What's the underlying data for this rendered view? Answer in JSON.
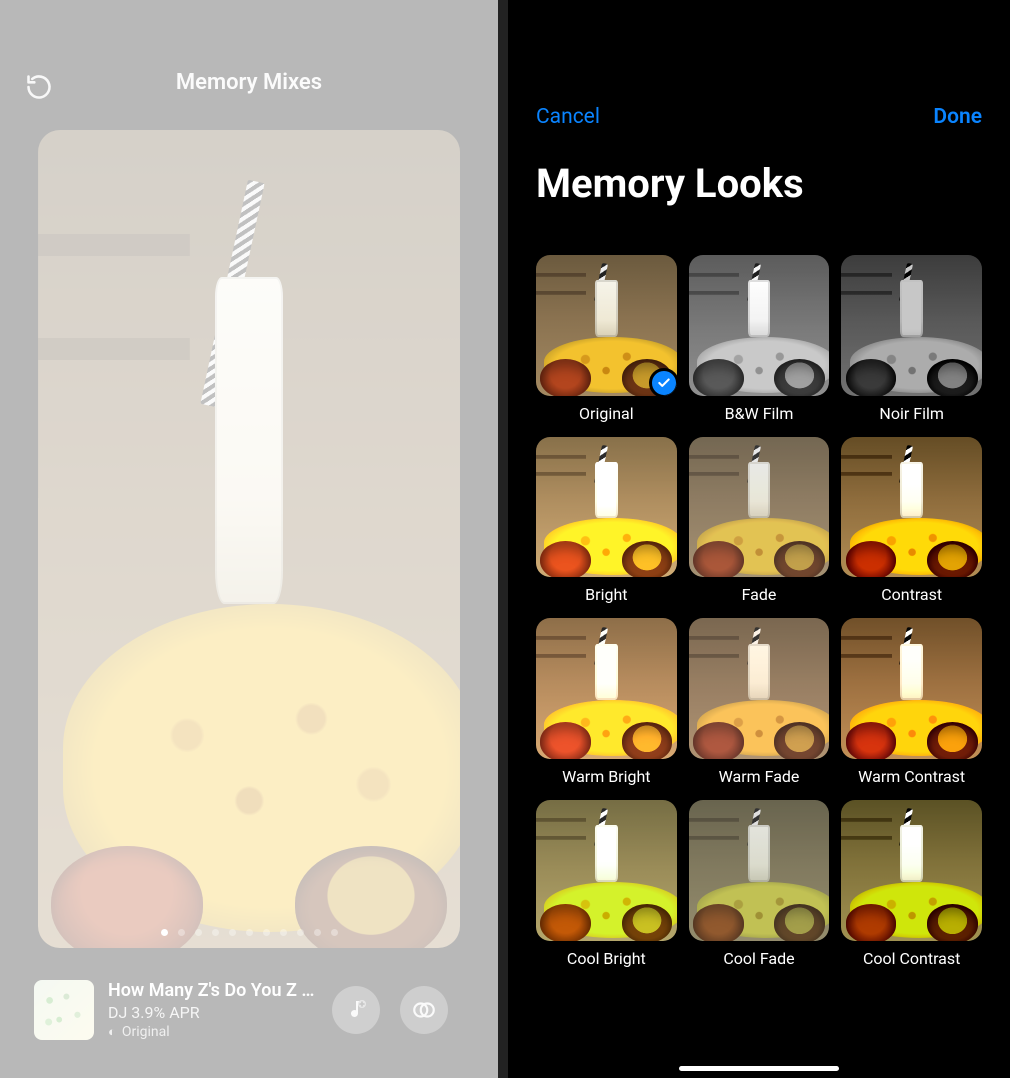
{
  "left": {
    "title": "Memory Mixes",
    "music": {
      "title": "How Many Z's Do You Z In…",
      "artist": "DJ 3.9% APR",
      "look_label": "Original"
    },
    "pager_count": 11,
    "pager_active_index": 0
  },
  "right": {
    "cancel": "Cancel",
    "done": "Done",
    "title": "Memory Looks",
    "selected_index": 0,
    "looks": [
      {
        "label": "Original",
        "filter_class": ""
      },
      {
        "label": "B&W Film",
        "filter_class": "f-bwfilm"
      },
      {
        "label": "Noir Film",
        "filter_class": "f-noirfilm"
      },
      {
        "label": "Bright",
        "filter_class": "f-bright"
      },
      {
        "label": "Fade",
        "filter_class": "f-fade"
      },
      {
        "label": "Contrast",
        "filter_class": "f-contrast"
      },
      {
        "label": "Warm Bright",
        "filter_class": "f-warmbright"
      },
      {
        "label": "Warm Fade",
        "filter_class": "f-warmfade"
      },
      {
        "label": "Warm Contrast",
        "filter_class": "f-warmcontrast"
      },
      {
        "label": "Cool Bright",
        "filter_class": "f-coolbright"
      },
      {
        "label": "Cool Fade",
        "filter_class": "f-coolfade"
      },
      {
        "label": "Cool Contrast",
        "filter_class": "f-coolcontrast"
      }
    ]
  }
}
